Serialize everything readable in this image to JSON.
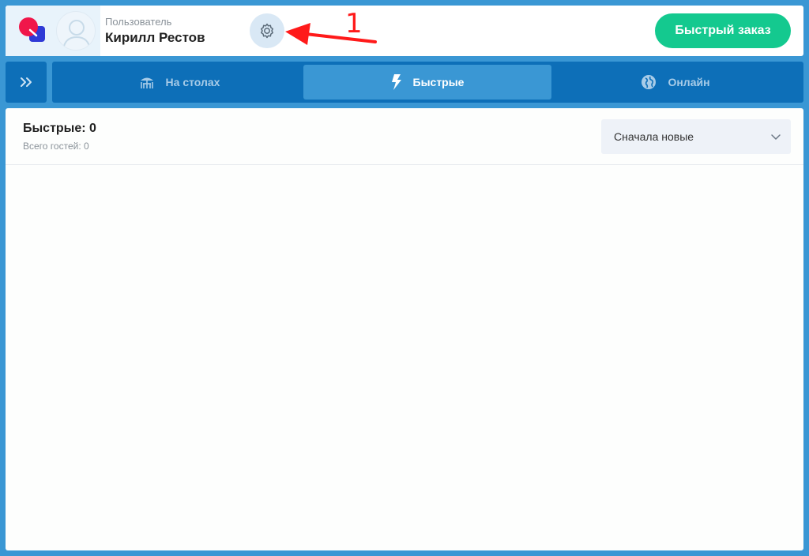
{
  "header": {
    "user_caption": "Пользователь",
    "user_name": "Кирилл Рестов",
    "quick_order_label": "Быстрый заказ",
    "annotation_number": "1"
  },
  "tabs": [
    {
      "label": "На столах",
      "icon": "table-umbrella-icon",
      "active": false
    },
    {
      "label": "Быстрые",
      "icon": "lightning-icon",
      "active": true
    },
    {
      "label": "Онлайн",
      "icon": "globe-icon",
      "active": false
    }
  ],
  "panel": {
    "title": "Быстрые: 0",
    "guests": "Всего гостей: 0",
    "sort_value": "Сначала новые"
  },
  "colors": {
    "background": "#3a97d4",
    "tabs_bar": "#0d6fb8",
    "accent_green": "#14c98f",
    "annotation_red": "#ff1a1a"
  }
}
